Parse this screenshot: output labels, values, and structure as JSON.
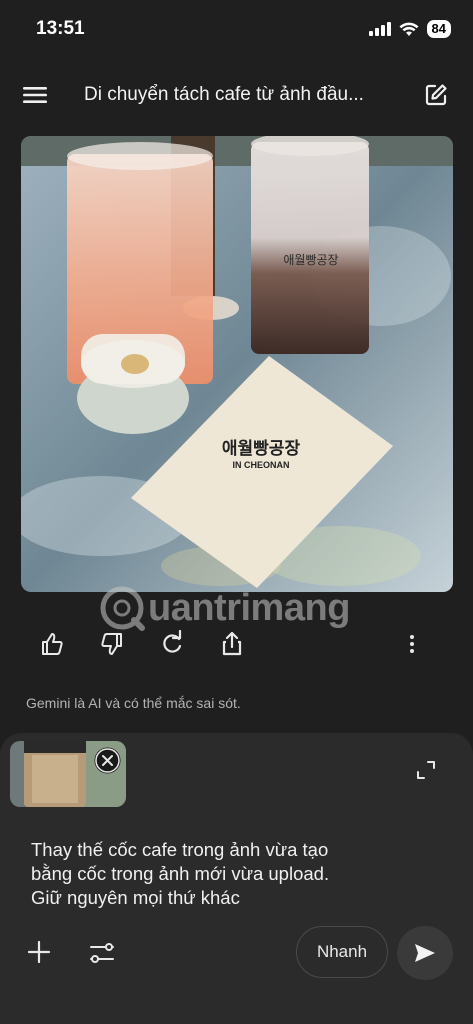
{
  "status_bar": {
    "time": "13:51",
    "battery": "84"
  },
  "header": {
    "title": "Di chuyển tách cafe từ ảnh đầu...",
    "menu_icon": "hamburger-menu-icon",
    "edit_icon": "edit-chat-icon"
  },
  "image": {
    "description_icon": "generated-image",
    "glass_logo_text": "애월빵공장",
    "napkin_logo_text": "애월빵공장",
    "napkin_sub_text": "IN CHEONAN"
  },
  "watermark": {
    "text": "uantrimang"
  },
  "response_actions": {
    "icons": [
      "thumbs-up-icon",
      "thumbs-down-icon",
      "regenerate-icon",
      "share-icon",
      "more-options-icon"
    ]
  },
  "disclaimer": "Gemini là AI và có thể mắc sai sót.",
  "composer": {
    "prompt_line_1": "Thay thế cốc cafe trong ảnh vừa tạo",
    "prompt_line_2": "bằng cốc trong ảnh mới vừa upload.",
    "prompt_line_3": "Giữ nguyên mọi thứ khác",
    "mode_label": "Nhanh",
    "icons": [
      "plus-icon",
      "tools-icon",
      "send-icon",
      "expand-icon",
      "close-icon"
    ]
  },
  "colors": {
    "background": "#1f1f1f",
    "composer": "#2b2b2b",
    "text": "#e8e8e8"
  }
}
